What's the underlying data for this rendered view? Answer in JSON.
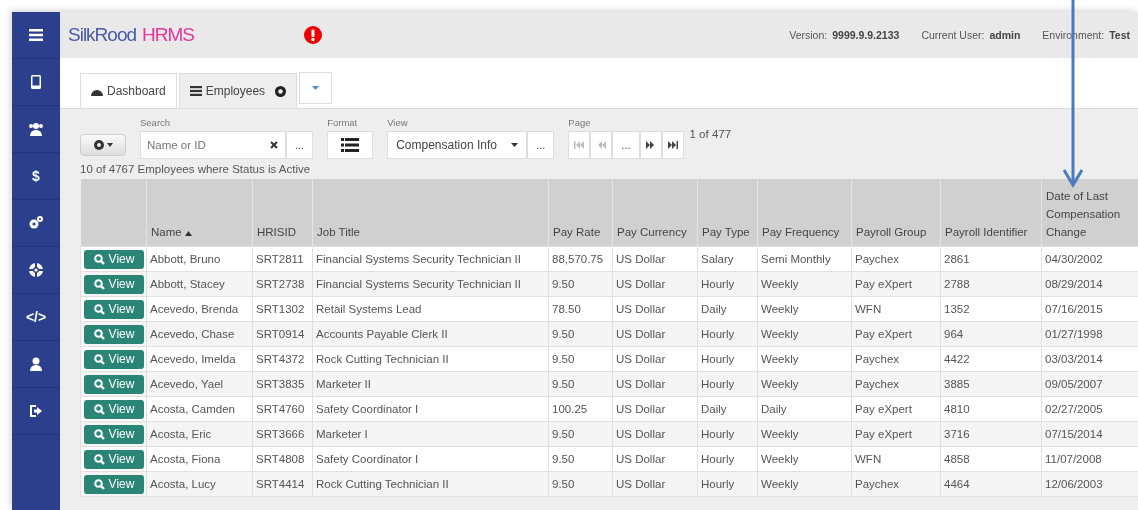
{
  "sidebar": {
    "items": [
      {
        "kind": "menu"
      },
      {
        "kind": "book"
      },
      {
        "kind": "users"
      },
      {
        "kind": "glyph",
        "text": "$"
      },
      {
        "kind": "cogs"
      },
      {
        "kind": "lifebuoy"
      },
      {
        "kind": "glyph",
        "text": "</>"
      },
      {
        "kind": "user"
      },
      {
        "kind": "signout"
      }
    ]
  },
  "header": {
    "logo": {
      "first": "SilkRood",
      "second": "HRMS"
    },
    "alert": true,
    "info": [
      {
        "label": "Version:",
        "value": "9999.9.9.2133"
      },
      {
        "label": "Current User:",
        "value": "admin"
      },
      {
        "label": "Environment:",
        "value": "Test"
      }
    ]
  },
  "tabs": [
    {
      "kind": "dashboard",
      "label": "Dashboard",
      "selected": false,
      "closable": false
    },
    {
      "kind": "list",
      "label": "Employees",
      "selected": true,
      "closable": true
    },
    {
      "kind": "dropdown",
      "selected": false,
      "closable": false
    }
  ],
  "toolbar": {
    "search": {
      "label": "Search",
      "placeholder": "Name or ID",
      "more": "..."
    },
    "format": {
      "label": "Format"
    },
    "view": {
      "label": "View",
      "value": "Compensation Info",
      "more": "..."
    },
    "page": {
      "label": "Page",
      "more": "...",
      "first_disabled": true,
      "prev_disabled": true,
      "position": "1 of 477"
    }
  },
  "summary": "10 of 4767 Employees where Status is Active",
  "table": {
    "columns": [
      {
        "label": "Name",
        "sorted": true
      },
      {
        "label": "HRISID",
        "sorted": false
      },
      {
        "label": "Job Title",
        "sorted": false
      },
      {
        "label": "Pay Rate",
        "sorted": false
      },
      {
        "label": "Pay Currency",
        "sorted": false
      },
      {
        "label": "Pay Type",
        "sorted": false
      },
      {
        "label": "Pay Frequency",
        "sorted": false
      },
      {
        "label": "Payroll Group",
        "sorted": false
      },
      {
        "label": "Payroll Identifier",
        "sorted": false
      },
      {
        "label": "Date of Last Compensation Change",
        "sorted": false
      }
    ],
    "rows": [
      {
        "action": "View",
        "cells": [
          "Abbott, Bruno",
          "SRT2811",
          "Financial Systems Security Technician II",
          "88,570.75",
          "US Dollar",
          "Salary",
          "Semi Monthly",
          "Paychex",
          "2861",
          "04/30/2002"
        ]
      },
      {
        "action": "View",
        "cells": [
          "Abbott, Stacey",
          "SRT2738",
          "Financial Systems Security Technician II",
          "9.50",
          "US Dollar",
          "Hourly",
          "Weekly",
          "Pay eXpert",
          "2788",
          "08/29/2014"
        ]
      },
      {
        "action": "View",
        "cells": [
          "Acevedo, Brenda",
          "SRT1302",
          "Retail Systems Lead",
          "78.50",
          "US Dollar",
          "Daily",
          "Weekly",
          "WFN",
          "1352",
          "07/16/2015"
        ]
      },
      {
        "action": "View",
        "cells": [
          "Acevedo, Chase",
          "SRT0914",
          "Accounts Payable Clerk II",
          "9.50",
          "US Dollar",
          "Hourly",
          "Weekly",
          "Pay eXpert",
          "964",
          "01/27/1998"
        ]
      },
      {
        "action": "View",
        "cells": [
          "Acevedo, Imelda",
          "SRT4372",
          "Rock Cutting Technician II",
          "9.50",
          "US Dollar",
          "Hourly",
          "Weekly",
          "Paychex",
          "4422",
          "03/03/2014"
        ]
      },
      {
        "action": "View",
        "cells": [
          "Acevedo, Yael",
          "SRT3835",
          "Marketer II",
          "9.50",
          "US Dollar",
          "Hourly",
          "Weekly",
          "Paychex",
          "3885",
          "09/05/2007"
        ]
      },
      {
        "action": "View",
        "cells": [
          "Acosta, Camden",
          "SRT4760",
          "Safety Coordinator I",
          "100.25",
          "US Dollar",
          "Daily",
          "Daily",
          "Pay eXpert",
          "4810",
          "02/27/2005"
        ]
      },
      {
        "action": "View",
        "cells": [
          "Acosta, Eric",
          "SRT3666",
          "Marketer I",
          "9.50",
          "US Dollar",
          "Hourly",
          "Weekly",
          "Pay eXpert",
          "3716",
          "07/15/2014"
        ]
      },
      {
        "action": "View",
        "cells": [
          "Acosta, Fiona",
          "SRT4808",
          "Safety Coordinator I",
          "9.50",
          "US Dollar",
          "Hourly",
          "Weekly",
          "WFN",
          "4858",
          "11/07/2008"
        ]
      },
      {
        "action": "View",
        "cells": [
          "Acosta, Lucy",
          "SRT4414",
          "Rock Cutting Technician II",
          "9.50",
          "US Dollar",
          "Hourly",
          "Weekly",
          "Paychex",
          "4464",
          "12/06/2003"
        ]
      }
    ]
  }
}
